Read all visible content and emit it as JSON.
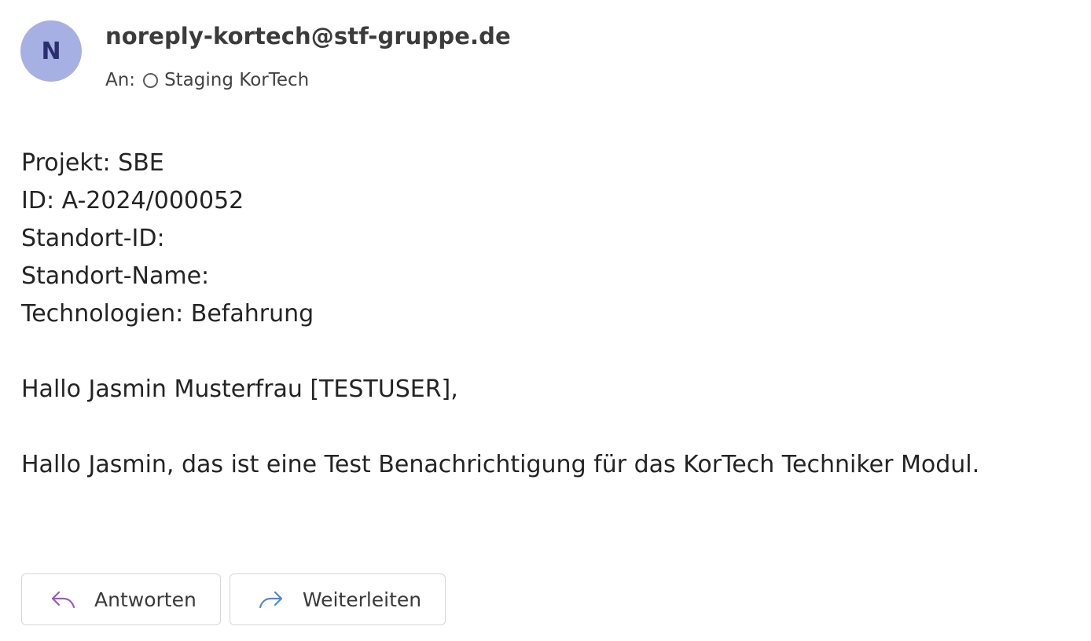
{
  "message": {
    "sender": {
      "initial": "N",
      "address": "noreply-kortech@stf-gruppe.de"
    },
    "to_label": "An:",
    "recipient": "Staging KorTech",
    "body": {
      "line1": "Projekt: SBE",
      "line2": "ID: A-2024/000052",
      "line3": "Standort-ID:",
      "line4": "Standort-Name:",
      "line5": "Technologien: Befahrung",
      "greeting": "Hallo Jasmin Musterfrau [TESTUSER],",
      "content": "Hallo Jasmin, das ist eine Test Benachrichtigung für das KorTech Techniker Modul."
    }
  },
  "actions": {
    "reply_label": "Antworten",
    "forward_label": "Weiterleiten"
  },
  "colors": {
    "avatar_bg": "#a6b0e3",
    "reply_icon": "#9b59c4",
    "forward_icon": "#4f86d9"
  }
}
